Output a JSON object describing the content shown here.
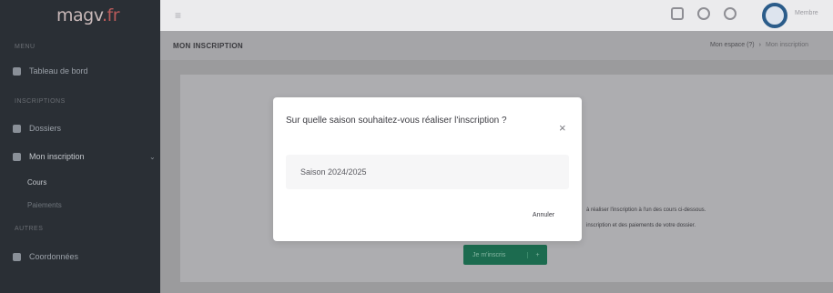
{
  "app": {
    "logo_name": "magv",
    "logo_tld": ".fr"
  },
  "sidebar": {
    "section_1": "Menu",
    "home": "Tableau de bord",
    "section_2": "Inscriptions",
    "dossiers": "Dossiers",
    "inscription": "Mon inscription",
    "sub_1": "Cours",
    "sub_2": "Paiements",
    "section_3": "Autres",
    "contact": "Coordonnées"
  },
  "topbar": {
    "menu_icon": "hamburger-icon",
    "user_name": "Membre"
  },
  "page": {
    "title": "MON INSCRIPTION",
    "breadcrumb_parent": "Mon espace (?)",
    "breadcrumb_current": "Mon inscription",
    "info_line_1": "à réaliser l'inscription à l'un des cours ci-dessous.",
    "info_line_2": "inscription et des paiements de votre dossier.",
    "cta_label": "Je m'inscris",
    "cta_icon": "+"
  },
  "modal": {
    "title": "Sur quelle saison souhaitez-vous réaliser l'inscription ?",
    "close_icon": "×",
    "season_option": "Saison 2024/2025",
    "cancel_label": "Annuler"
  }
}
